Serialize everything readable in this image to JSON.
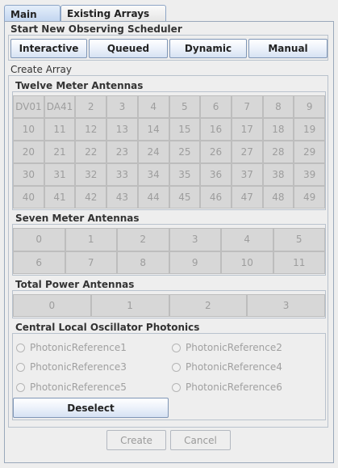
{
  "tabs": [
    {
      "label": "Main",
      "active": true
    },
    {
      "label": "Existing Arrays",
      "active": false
    }
  ],
  "scheduler": {
    "title": "Start New Observing Scheduler",
    "buttons": [
      "Interactive",
      "Queued",
      "Dynamic",
      "Manual"
    ]
  },
  "create_array": {
    "title": "Create Array",
    "twelve_meter": {
      "title": "Twelve Meter Antennas",
      "antennas": [
        "DV01",
        "DA41",
        "2",
        "3",
        "4",
        "5",
        "6",
        "7",
        "8",
        "9",
        "10",
        "11",
        "12",
        "13",
        "14",
        "15",
        "16",
        "17",
        "18",
        "19",
        "20",
        "21",
        "22",
        "23",
        "24",
        "25",
        "26",
        "27",
        "28",
        "29",
        "30",
        "31",
        "32",
        "33",
        "34",
        "35",
        "36",
        "37",
        "38",
        "39",
        "40",
        "41",
        "42",
        "43",
        "44",
        "45",
        "46",
        "47",
        "48",
        "49"
      ]
    },
    "seven_meter": {
      "title": "Seven Meter Antennas",
      "antennas": [
        "0",
        "1",
        "2",
        "3",
        "4",
        "5",
        "6",
        "7",
        "8",
        "9",
        "10",
        "11"
      ]
    },
    "total_power": {
      "title": "Total Power Antennas",
      "antennas": [
        "0",
        "1",
        "2",
        "3"
      ]
    },
    "photonics": {
      "title": "Central Local Oscillator Photonics",
      "options": [
        "PhotonicReference1",
        "PhotonicReference2",
        "PhotonicReference3",
        "PhotonicReference4",
        "PhotonicReference5",
        "PhotonicReference6"
      ],
      "deselect_label": "Deselect"
    }
  },
  "footer": {
    "create_label": "Create",
    "cancel_label": "Cancel"
  },
  "colors": {
    "accent": "#bfd3ef",
    "disabled_cell": "#d7d7d7",
    "disabled_text": "#9d9d9d"
  }
}
